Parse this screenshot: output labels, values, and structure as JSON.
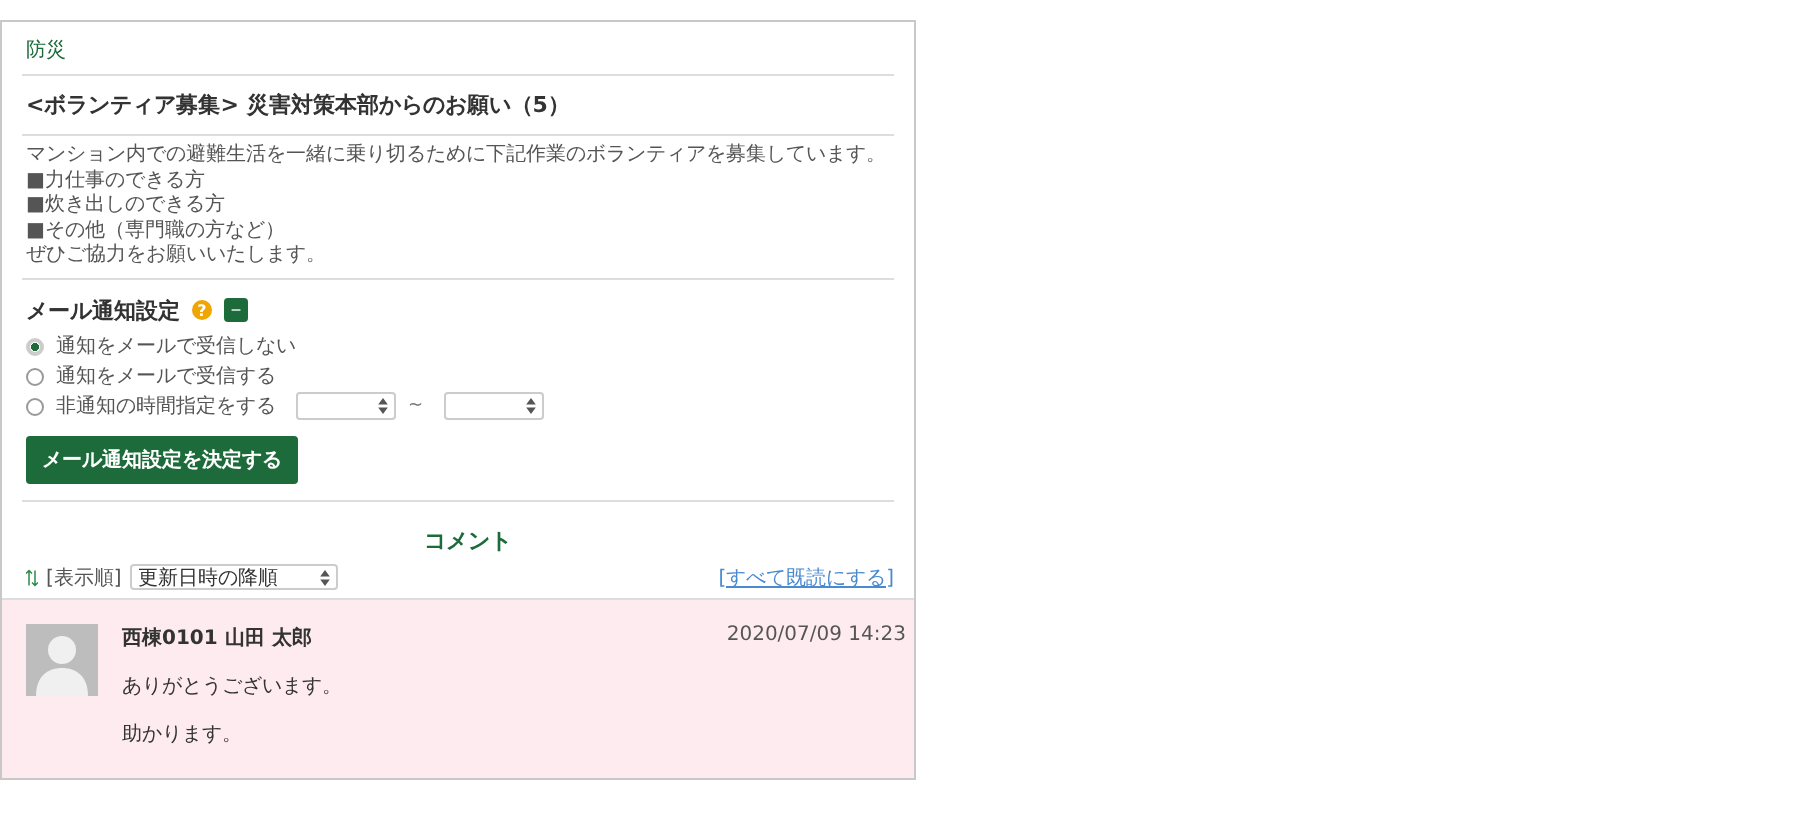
{
  "category": "防災",
  "title": "<ボランティア募集> 災害対策本部からのお願い（5）",
  "body": [
    "マンション内での避難生活を一緒に乗り切るために下記作業のボランティアを募集しています。",
    "■力仕事のできる方",
    "■炊き出しのできる方",
    "■その他（専門職の方など）",
    "ぜひご協力をお願いいたします。"
  ],
  "mail_settings": {
    "title": "メール通知設定",
    "help_icon": "?",
    "collapse_icon": "−",
    "expanded": true,
    "options": [
      {
        "label": "通知をメールで受信しない",
        "selected": true,
        "kind": "plain"
      },
      {
        "label": "通知をメールで受信する",
        "selected": false,
        "kind": "plain"
      },
      {
        "label": "非通知の時間指定をする",
        "selected": false,
        "kind": "time_range"
      }
    ],
    "range_separator": "~",
    "submit": "メール通知設定を決定する"
  },
  "comments": {
    "title": "コメント",
    "sort_label": "[表示順]",
    "sort_value": "更新日時の降順",
    "mark_all_read": "[すべて既読にする]",
    "items": [
      {
        "author": "西棟0101 山田 太郎",
        "time": "2020/07/09 14:23",
        "lines": [
          "ありがとうございます。",
          "助かります。"
        ],
        "unread": true
      }
    ]
  }
}
